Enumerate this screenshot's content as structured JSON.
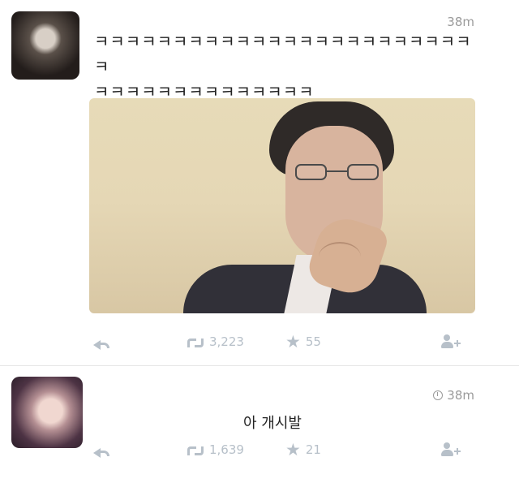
{
  "tweets": [
    {
      "time": "38m",
      "text_lines": [
        "ㅋㅋㅋㅋㅋㅋㅋㅋㅋㅋㅋㅋㅋㅋㅋㅋㅋㅋㅋㅋㅋㅋㅋㅋㅋ",
        "ㅋㅋㅋㅋㅋㅋㅋㅋㅋㅋㅋㅋㅋㅋ"
      ],
      "retweets": "3,223",
      "likes": "55",
      "icons": [
        "reply-icon",
        "retweet-icon",
        "star-icon",
        "follow-icon"
      ]
    },
    {
      "time": "38m",
      "text": "아 개시발",
      "retweets": "1,639",
      "likes": "21",
      "icons": [
        "clock-icon",
        "reply-icon",
        "retweet-icon",
        "star-icon",
        "follow-icon"
      ]
    }
  ]
}
